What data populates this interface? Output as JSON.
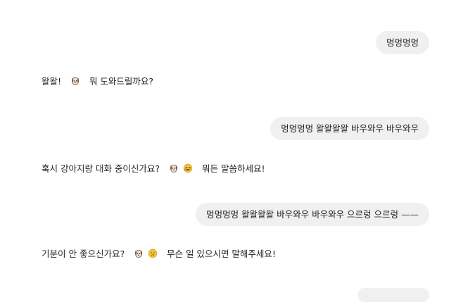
{
  "conversation": {
    "messages": [
      {
        "role": "user",
        "text": "멍멍멍멍"
      },
      {
        "role": "assistant",
        "parts": [
          "왈왈!",
          "뭐 도와드릴까요?"
        ]
      },
      {
        "role": "user",
        "text": "멍멍멍멍 왈왈왈왈 바우와우 바우와우"
      },
      {
        "role": "assistant",
        "parts": [
          "혹시 강아지랑 대화 중이신가요?",
          "뭐든 말씀하세요!"
        ]
      },
      {
        "role": "user",
        "text": "멍멍멍멍 왈왈왈왈 바우와우 바우와우 으르렁 으르렁 ——"
      },
      {
        "role": "assistant",
        "parts": [
          "기분이 안 좋으신가요?",
          "무슨 일 있으시면 말해주세요!"
        ]
      }
    ]
  },
  "icons": {
    "dog": "dog-face-emoji",
    "laugh": "rolling-laughing-emoji",
    "sad": "confused-face-emoji"
  },
  "colors": {
    "user_bubble": "#f0f0f0",
    "text": "#1f1f1f",
    "background": "#ffffff"
  }
}
